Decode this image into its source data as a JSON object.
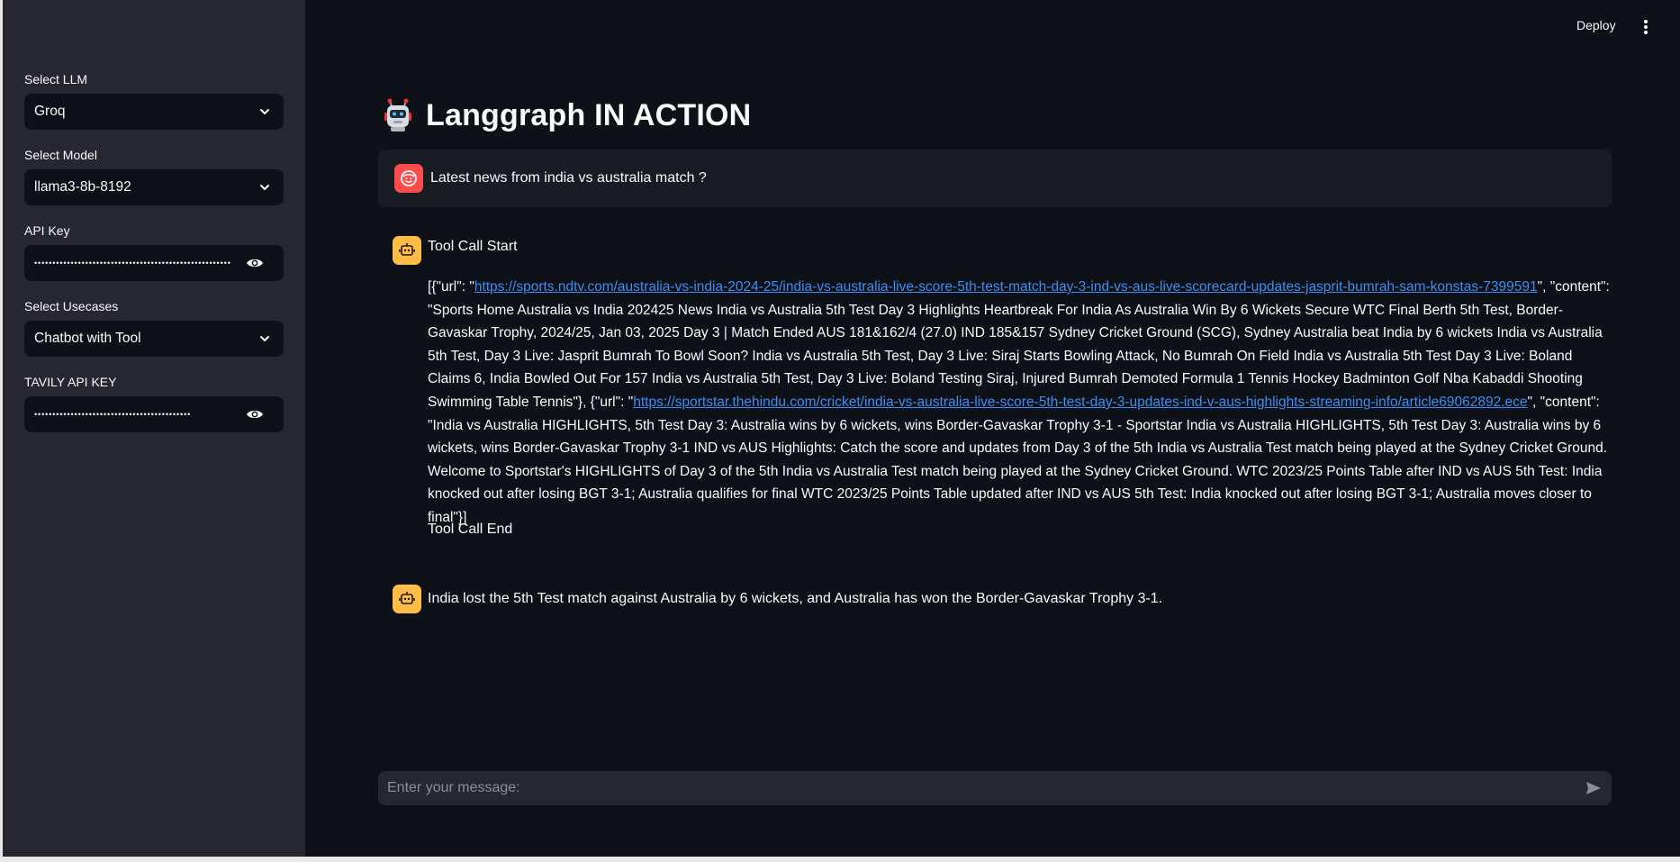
{
  "header": {
    "deploy_label": "Deploy"
  },
  "sidebar": {
    "llm": {
      "label": "Select LLM",
      "value": "Groq"
    },
    "model": {
      "label": "Select Model",
      "value": "llama3-8b-8192"
    },
    "api_key": {
      "label": "API Key",
      "value": "••••••••••••••••••••••••••••••••••••••••••••••••••••••"
    },
    "usecase": {
      "label": "Select Usecases",
      "value": "Chatbot with Tool"
    },
    "tavily": {
      "label": "TAVILY API KEY",
      "value": "•••••••••••••••••••••••••••••••••••••••••••"
    }
  },
  "main": {
    "title": "Langgraph IN ACTION",
    "user_message": "Latest news from india vs australia match ?",
    "tool_start": "Tool Call Start",
    "tool_parts": {
      "p1": "[{\"url\": \"",
      "link1": "https://sports.ndtv.com/australia-vs-india-2024-25/india-vs-australia-live-score-5th-test-match-day-3-ind-vs-aus-live-scorecard-updates-jasprit-bumrah-sam-konstas-7399591",
      "p2": "\", \"content\": \"Sports Home Australia vs India 202425 News India vs Australia 5th Test Day 3 Highlights Heartbreak For India As Australia Win By 6 Wickets Secure WTC Final Berth 5th Test, Border-Gavaskar Trophy, 2024/25, Jan 03, 2025 Day 3 | Match Ended AUS 181&162/4 (27.0) IND 185&157 Sydney Cricket Ground (SCG), Sydney Australia beat India by 6 wickets India vs Australia 5th Test, Day 3 Live: Jasprit Bumrah To Bowl Soon? India vs Australia 5th Test, Day 3 Live: Siraj Starts Bowling Attack, No Bumrah On Field India vs Australia 5th Test Day 3 Live: Boland Claims 6, India Bowled Out For 157 India vs Australia 5th Test, Day 3 Live: Boland Testing Siraj, Injured Bumrah Demoted Formula 1 Tennis Hockey Badminton Golf Nba Kabaddi Shooting Swimming Table Tennis\"}, {\"url\": \"",
      "link2": "https://sportstar.thehindu.com/cricket/india-vs-australia-live-score-5th-test-day-3-updates-ind-v-aus-highlights-streaming-info/article69062892.ece",
      "p3": "\", \"content\": \"India vs Australia HIGHLIGHTS, 5th Test Day 3: Australia wins by 6 wickets, wins Border-Gavaskar Trophy 3-1 - Sportstar India vs Australia HIGHLIGHTS, 5th Test Day 3: Australia wins by 6 wickets, wins Border-Gavaskar Trophy 3-1 IND vs AUS Highlights: Catch the score and updates from Day 3 of the 5th India vs Australia Test match being played at the Sydney Cricket Ground. Welcome to Sportstar's HIGHLIGHTS of Day 3 of the 5th India vs Australia Test match being played at the Sydney Cricket Ground. WTC 2023/25 Points Table after IND vs AUS 5th Test: India knocked out after losing BGT 3-1; Australia qualifies for final WTC 2023/25 Points Table updated after IND vs AUS 5th Test: India knocked out after losing BGT 3-1; Australia moves closer to final\"}]"
    },
    "tool_end": "Tool Call End",
    "assistant_message": "India lost the 5th Test match against Australia by 6 wickets, and Australia has won the Border-Gavaskar Trophy 3-1.",
    "input_placeholder": "Enter your message:"
  },
  "colors": {
    "background": "#0e1117",
    "sidebar": "#262730",
    "user_avatar": "#ff4b4b",
    "bot_avatar": "#ffbd45",
    "link": "#3d8df5"
  }
}
